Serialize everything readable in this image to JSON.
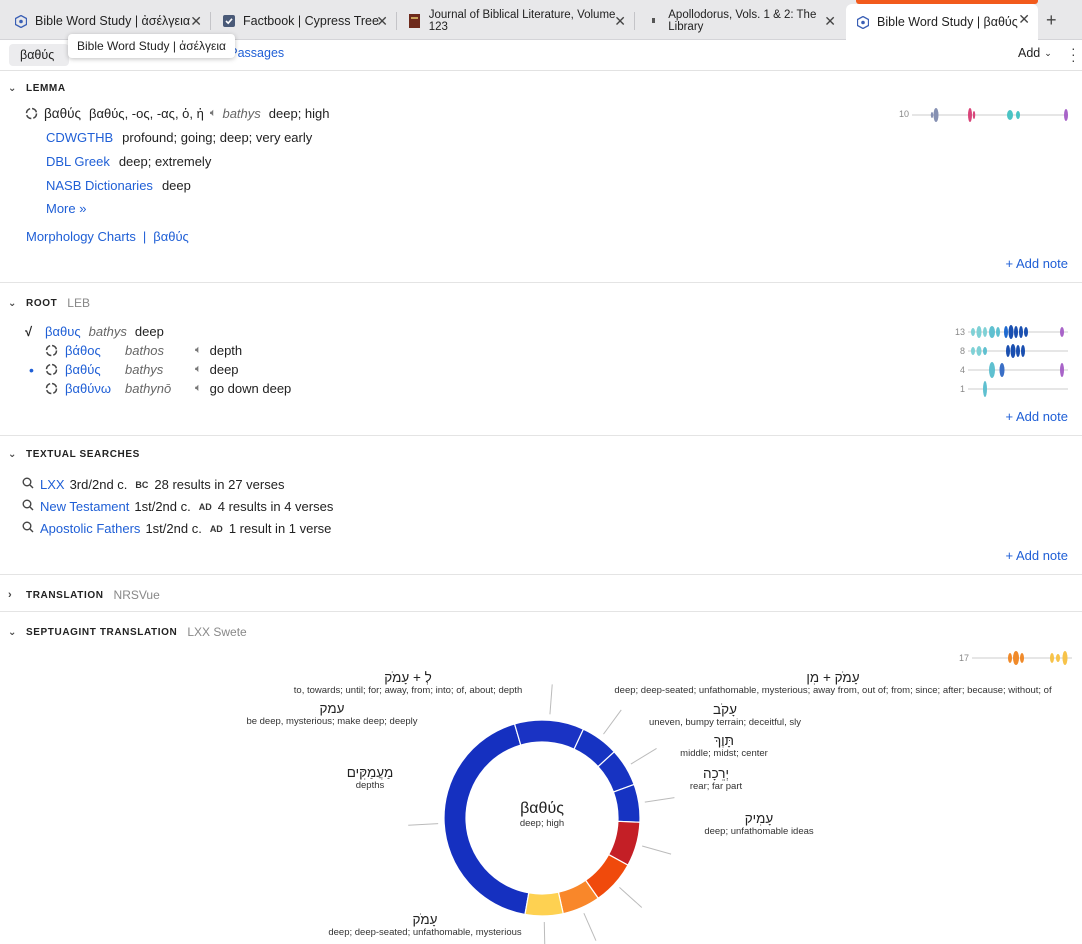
{
  "tabs": [
    {
      "label": "Bible Word Study | ἀσέλγεια",
      "icon": "word-study-icon",
      "active": false
    },
    {
      "label": "Factbook | Cypress Tree",
      "icon": "factbook-icon",
      "active": false
    },
    {
      "label": "Journal of Biblical Literature, Volume 123",
      "icon": "book-icon",
      "active": false
    },
    {
      "label": "Apollodorus, Vols. 1 & 2: The Library",
      "icon": "book-icon",
      "active": false
    },
    {
      "label": "Bible Word Study | βαθύς",
      "icon": "word-study-icon",
      "active": true
    }
  ],
  "new_tab": "+",
  "subbar": {
    "search_value": "βαθύς",
    "passages_label": "l Passages",
    "add_label": "Add",
    "tooltip": "Bible Word Study | ἀσέλγεια"
  },
  "lemma": {
    "title": "LEMMA",
    "headword": "βαθύς",
    "forms": "βαθύς, -ος, -ας, ὁ, ἡ",
    "translit": "bathys",
    "gloss": "deep; high",
    "defs": [
      {
        "source": "CDWGTHB",
        "text": "profound; going; deep; very early"
      },
      {
        "source": "DBL Greek",
        "text": "deep; extremely"
      },
      {
        "source": "NASB Dictionaries",
        "text": "deep"
      }
    ],
    "more": "More »",
    "morph_link": "Morphology Charts",
    "morph_sep": "|",
    "morph_word": "βαθύς",
    "count": "10",
    "add_note": "+ Add note"
  },
  "root": {
    "title": "ROOT",
    "sub": "LEB",
    "items": [
      {
        "word": "βαθυς",
        "translit": "bathys",
        "gloss": "deep",
        "count": "13",
        "marker": "√"
      },
      {
        "word": "βάθος",
        "translit": "bathos",
        "gloss": "depth",
        "count": "8"
      },
      {
        "word": "βαθύς",
        "translit": "bathys",
        "gloss": "deep",
        "count": "4",
        "current": "•"
      },
      {
        "word": "βαθύνω",
        "translit": "bathynō",
        "gloss": "go down deep",
        "count": "1"
      }
    ],
    "add_note": "+ Add note"
  },
  "textual": {
    "title": "TEXTUAL SEARCHES",
    "items": [
      {
        "corpus": "LXX",
        "date": "3rd/2nd c.",
        "era": "BC",
        "result": "28 results in 27 verses"
      },
      {
        "corpus": "New Testament",
        "date": "1st/2nd c.",
        "era": "AD",
        "result": "4 results in 4 verses"
      },
      {
        "corpus": "Apostolic Fathers",
        "date": "1st/2nd c.",
        "era": "AD",
        "result": "1 result in 1 verse"
      }
    ],
    "add_note": "+ Add note"
  },
  "translation": {
    "title": "TRANSLATION",
    "sub": "NRSVue"
  },
  "septuagint": {
    "title": "SEPTUAGINT TRANSLATION",
    "sub": "LXX Swete",
    "count": "17"
  },
  "chart_data": {
    "type": "pie",
    "center_word": "βαθύς",
    "center_gloss": "deep; high",
    "slices": [
      {
        "label": "עָמֹק",
        "gloss": "deep; deep-seated; unfathomable, mysterious",
        "value": 41,
        "color": "#1530c0"
      },
      {
        "label": "מַעֲמַקִּים",
        "gloss": "depths",
        "value": 11,
        "color": "#1a33c4"
      },
      {
        "label": "עמק",
        "gloss": "be deep, mysterious; make deep; deeply",
        "value": 6,
        "color": "#1633c2"
      },
      {
        "label": "לְ + עָמֹק",
        "gloss": "to, towards; until; for; away, from; into; of, about; depth",
        "value": 6,
        "color": "#1733c2"
      },
      {
        "label": "עָמֹק + מִן",
        "gloss": "deep; deep-seated; unfathomable, mysterious; away from, out of; from; since; after; because; without; of",
        "value": 6,
        "color": "#1633c2"
      },
      {
        "label": "עָקֹב",
        "gloss": "uneven, bumpy terrain; deceitful, sly",
        "value": 7,
        "color": "#c41f26"
      },
      {
        "label": "תָּוֶךְ",
        "gloss": "middle; midst; center",
        "value": 7,
        "color": "#f04a0c"
      },
      {
        "label": "יְרֵכָה",
        "gloss": "rear; far part",
        "value": 6,
        "color": "#f9872a"
      },
      {
        "label": "עָמִיק",
        "gloss": "deep; unfathomable ideas",
        "value": 6,
        "color": "#fed151"
      }
    ]
  }
}
